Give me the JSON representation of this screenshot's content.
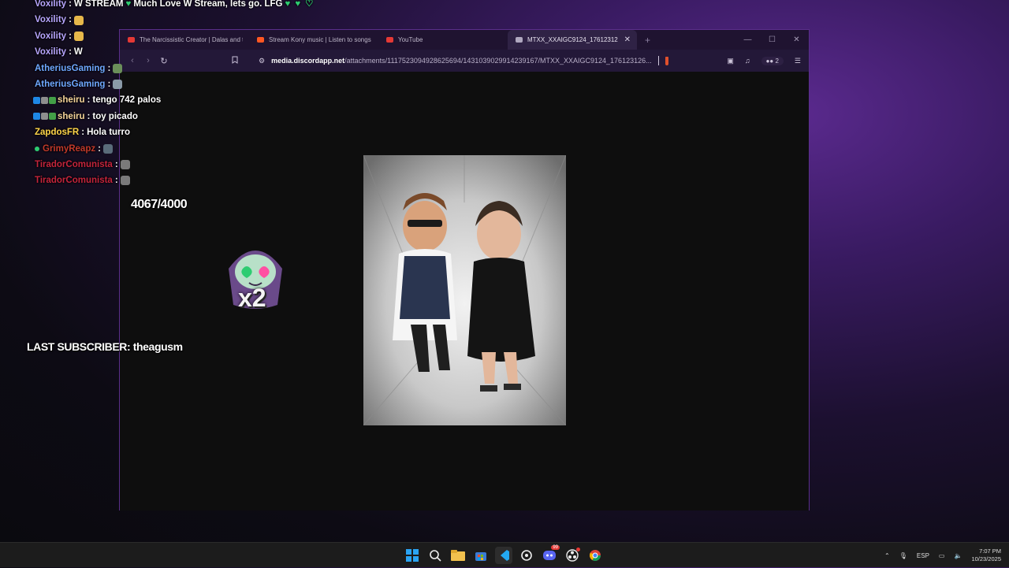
{
  "chat": [
    {
      "user": "Voxility",
      "color": "#b8a6ff",
      "msg": "W STREAM",
      "extra": "Much Love W Stream, lets go. LFG",
      "hearts": true
    },
    {
      "user": "Voxility",
      "color": "#b8a6ff",
      "msg": "",
      "emote_color": "#e7b84a"
    },
    {
      "user": "Voxility",
      "color": "#b8a6ff",
      "msg": "",
      "emote_color": "#e7b84a"
    },
    {
      "user": "Voxility",
      "color": "#b8a6ff",
      "msg": "W"
    },
    {
      "user": "AtheriusGaming",
      "color": "#6fa8ff",
      "msg": "",
      "emote_color": "#6b8f5a"
    },
    {
      "user": "AtheriusGaming",
      "color": "#6fa8ff",
      "msg": "",
      "emote_color": "#8a9aa8"
    },
    {
      "user": "sheiru",
      "color": "#f5d49a",
      "msg": "tengo 742 palos",
      "badges": true
    },
    {
      "user": "sheiru",
      "color": "#f5d49a",
      "msg": "toy picado",
      "badges": true
    },
    {
      "user": "ZapdosFR",
      "color": "#ffd54a",
      "msg": "Hola turro"
    },
    {
      "user": "GrimyReapz",
      "color": "#c0392b",
      "msg": "",
      "dot": true,
      "emote_color": "#5a6c7a"
    },
    {
      "user": "TiradorComunista",
      "color": "#c4243c",
      "msg": "",
      "emote_color": "#7a7a7a"
    },
    {
      "user": "TiradorComunista",
      "color": "#c4243c",
      "msg": "",
      "emote_color": "#7a7a7a"
    }
  ],
  "overlay": {
    "counter": "4067/4000",
    "multiplier": "x2",
    "last_subscriber": "LAST SUBSCRIBER: theagusm"
  },
  "browser": {
    "tabs": [
      {
        "title": "The Narcissistic Creator | Dalas and t",
        "favicon": "#e53935",
        "active": false
      },
      {
        "title": "Stream Kony music | Listen to songs",
        "favicon": "#ff5722",
        "active": false
      },
      {
        "title": "YouTube",
        "favicon": "#e53935",
        "active": false
      },
      {
        "title": "MTXX_XXAIGC9124_17612312",
        "favicon": "#b0a8c0",
        "active": true
      }
    ],
    "new_tab": "+",
    "url_host": "media.discordapp.net",
    "url_path": "/attachments/1117523094928625694/1431039029914239167/MTXX_XXAIGC9124_176123126...",
    "vpn_count": "2"
  },
  "taskbar": {
    "lang": "ESP",
    "time": "7:07 PM",
    "date": "10/23/2025",
    "discord_badge": "99"
  }
}
